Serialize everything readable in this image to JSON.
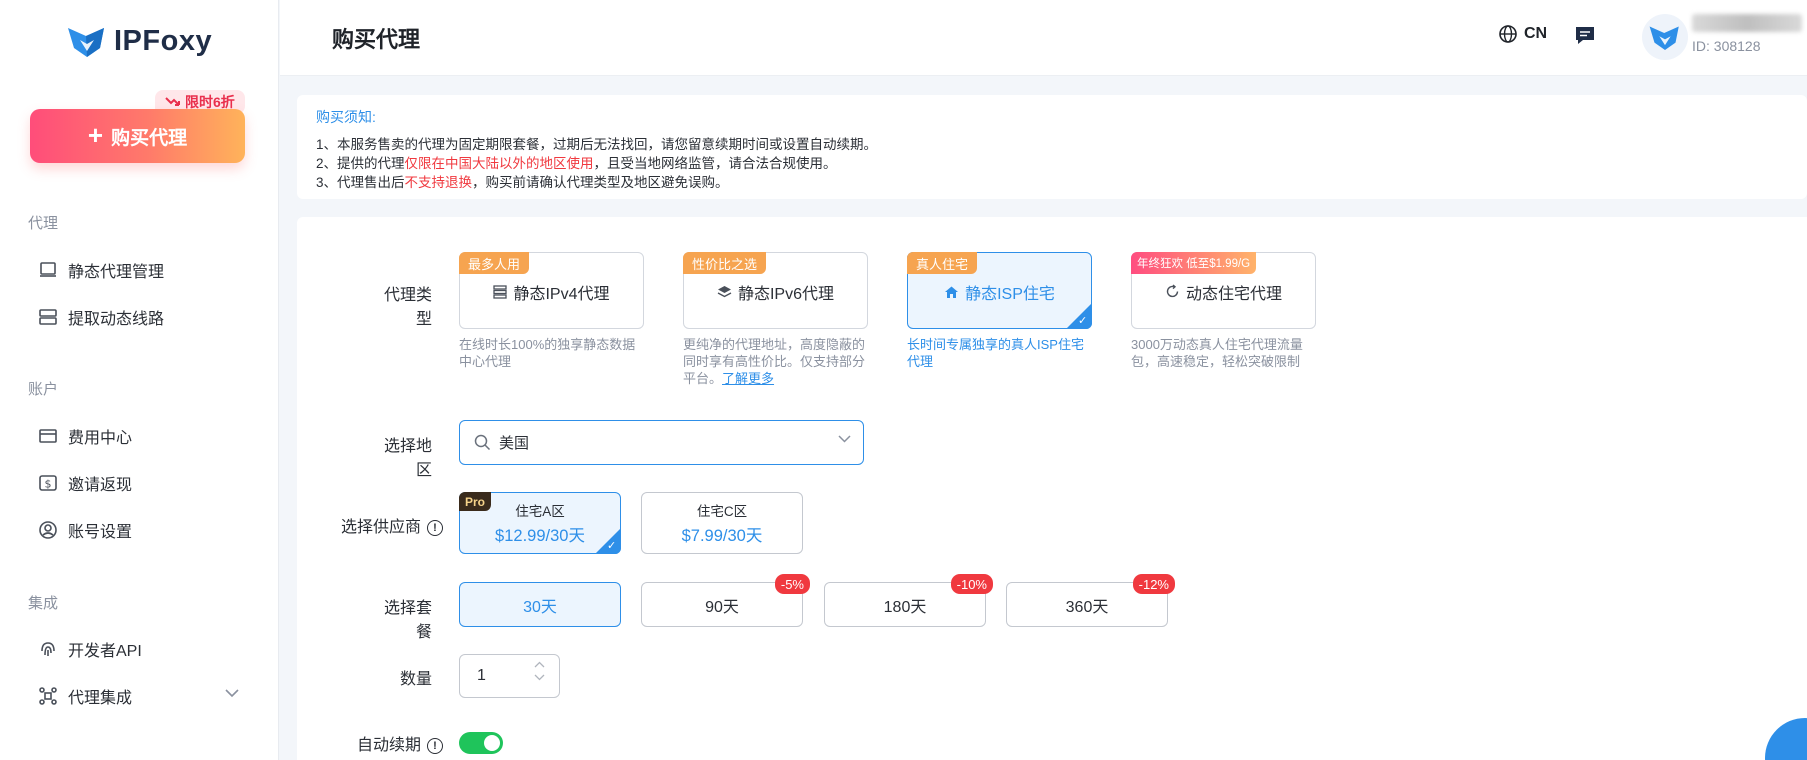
{
  "brand": {
    "name": "IPFoxy"
  },
  "sidebar": {
    "buy_button": "购买代理",
    "promo_badge": "限时6折",
    "sections": [
      {
        "title": "代理",
        "items": [
          "静态代理管理",
          "提取动态线路"
        ]
      },
      {
        "title": "账户",
        "items": [
          "费用中心",
          "邀请返现",
          "账号设置"
        ]
      },
      {
        "title": "集成",
        "items": [
          "开发者API",
          "代理集成"
        ]
      }
    ]
  },
  "header": {
    "title": "购买代理",
    "lang": "CN",
    "user_id": "ID: 308128"
  },
  "notice": {
    "title": "购买须知:",
    "line1": "1、本服务售卖的代理为固定期限套餐，过期后无法找回，请您留意续期时间或设置自动续期。",
    "line2_a": "2、提供的代理",
    "line2_red": "仅限在中国大陆以外的地区使用",
    "line2_b": "，且受当地网络监管，请合法合规使用。",
    "line3_a": "3、代理售出后",
    "line3_red": "不支持退换",
    "line3_b": "，购买前请确认代理类型及地区避免误购。"
  },
  "form": {
    "proxy_type_label": "代理类型",
    "proxy_types": [
      {
        "tag": "最多人用",
        "name": "静态IPv4代理",
        "desc": "在线时长100%的独享静态数据中心代理"
      },
      {
        "tag": "性价比之选",
        "name": "静态IPv6代理",
        "desc": "更纯净的代理地址，高度隐蔽的同时享有高性价比。仅支持部分平台。",
        "link": "了解更多"
      },
      {
        "tag": "真人住宅",
        "name": "静态ISP住宅",
        "desc": "长时间专属独享的真人ISP住宅代理"
      },
      {
        "tag": "年终狂欢 低至$1.99/G",
        "name": "动态住宅代理",
        "desc": "3000万动态真人住宅代理流量包，高速稳定，轻松突破限制"
      }
    ],
    "region_label": "选择地区",
    "region_value": "美国",
    "supplier_label": "选择供应商",
    "suppliers": [
      {
        "tag": "Pro",
        "name": "住宅A区",
        "price": "$12.99/30天"
      },
      {
        "name": "住宅C区",
        "price": "$7.99/30天"
      }
    ],
    "plan_label": "选择套餐",
    "plans": [
      {
        "label": "30天"
      },
      {
        "label": "90天",
        "discount": "-5%"
      },
      {
        "label": "180天",
        "discount": "-10%"
      },
      {
        "label": "360天",
        "discount": "-12%"
      }
    ],
    "qty_label": "数量",
    "qty_value": "1",
    "auto_renew_label": "自动续期"
  },
  "colors": {
    "accent": "#2e8fe8",
    "danger": "#f0393f",
    "toggle_on": "#1fc45b"
  }
}
